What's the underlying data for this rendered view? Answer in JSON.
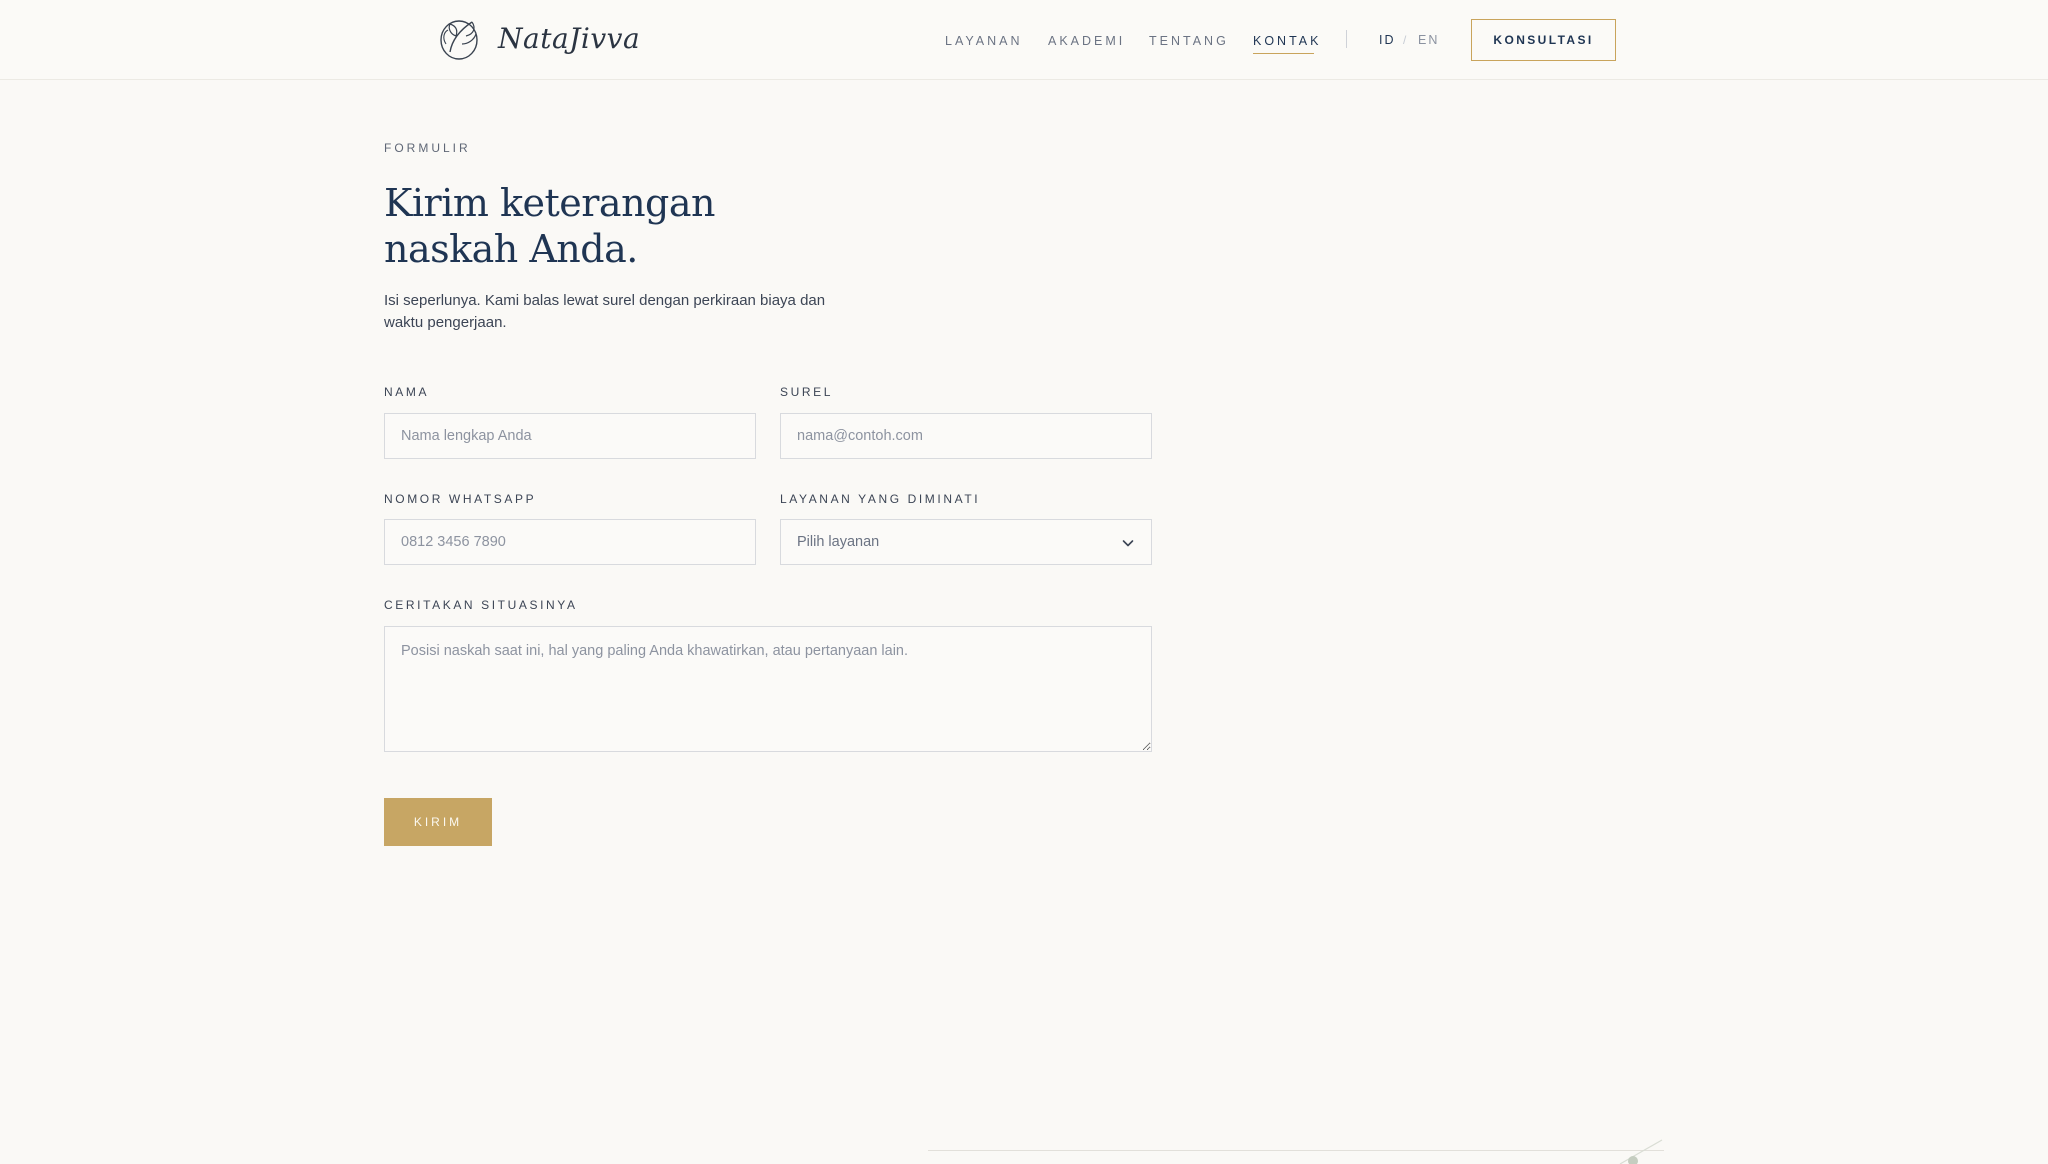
{
  "brand": {
    "name": "NataJivva"
  },
  "nav": {
    "items": [
      {
        "label": "LAYANAN"
      },
      {
        "label": "AKADEMI"
      },
      {
        "label": "TENTANG"
      },
      {
        "label": "KONTAK"
      }
    ],
    "active": "KONTAK"
  },
  "lang": {
    "id": "ID",
    "separator": "/",
    "en": "EN",
    "active": "ID"
  },
  "cta": {
    "label": "KONSULTASI"
  },
  "form": {
    "eyebrow": "FORMULIR",
    "title": "Kirim keterangan naskah Anda.",
    "description": "Isi seperlunya. Kami balas lewat surel dengan perkiraan biaya dan waktu pengerjaan.",
    "name": {
      "label": "NAMA",
      "placeholder": "Nama lengkap Anda"
    },
    "email": {
      "label": "SUREL",
      "placeholder": "nama@contoh.com"
    },
    "whatsapp": {
      "label": "NOMOR WHATSAPP",
      "placeholder": "0812 3456 7890"
    },
    "service": {
      "label": "LAYANAN YANG DIMINATI",
      "selected": "Pilih layanan"
    },
    "situation": {
      "label": "CERITAKAN SITUASINYA",
      "placeholder": "Posisi naskah saat ini, hal yang paling Anda khawatirkan, atau pertanyaan lain."
    },
    "submit_label": "KIRIM"
  },
  "colors": {
    "accent": "#c9a45c",
    "navy": "#1f3553",
    "background": "#faf9f6"
  }
}
